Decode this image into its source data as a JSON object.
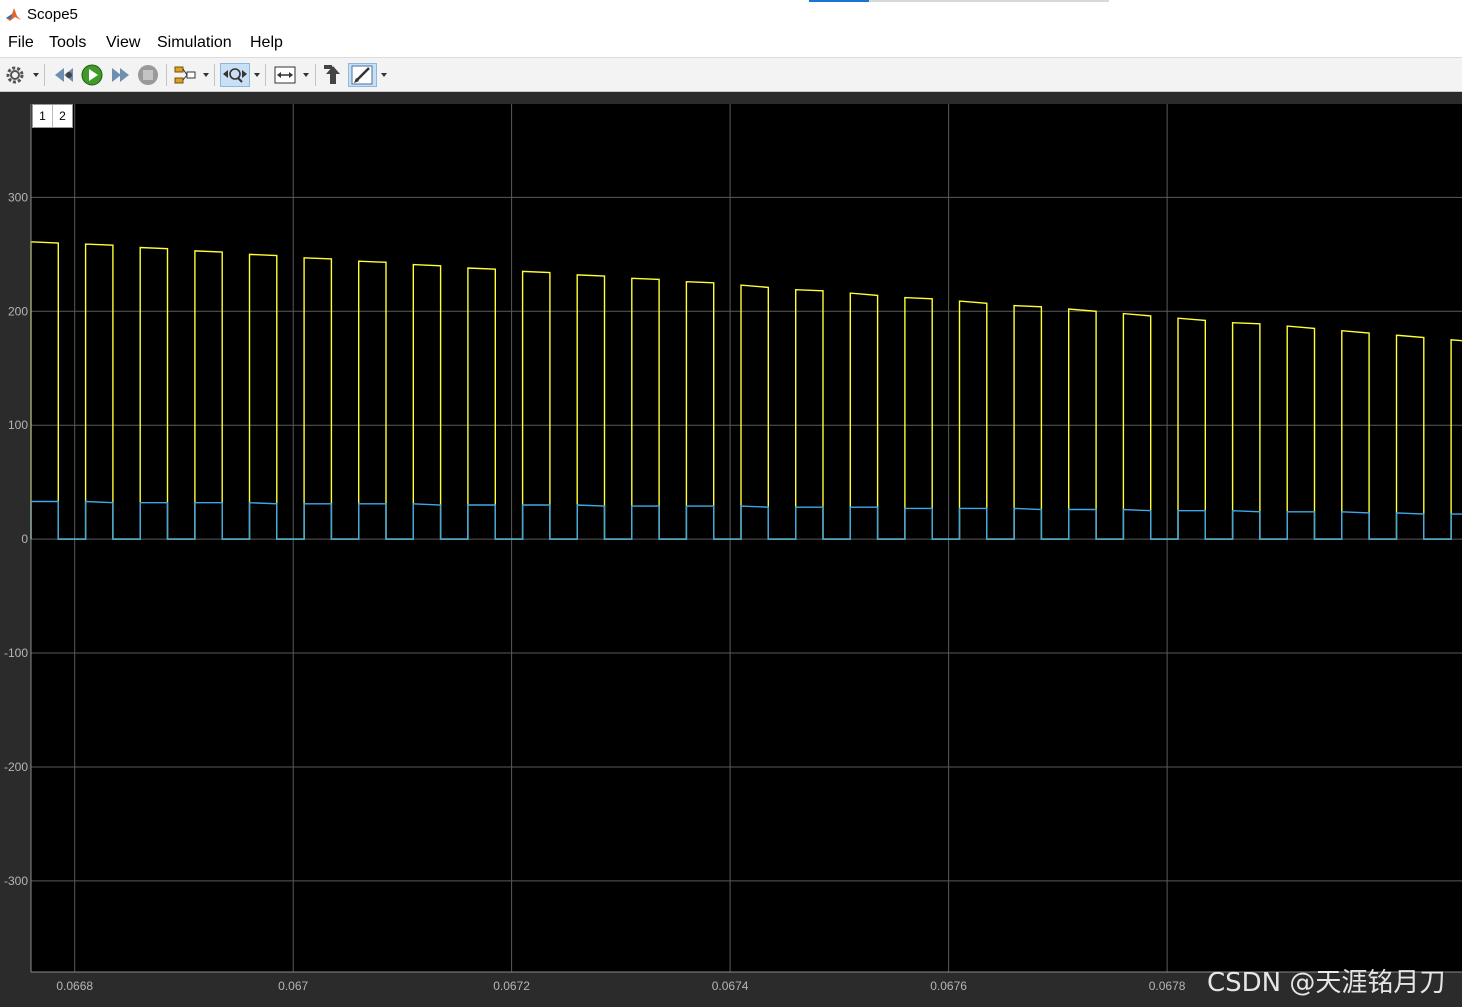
{
  "window": {
    "title": "Scope5"
  },
  "menu": [
    "File",
    "Tools",
    "View",
    "Simulation",
    "Help"
  ],
  "toolbar": {
    "icons": [
      "gear-icon",
      "step-back-icon",
      "run-icon",
      "step-forward-icon",
      "stop-icon",
      "signal-selector-icon",
      "zoom-icon",
      "fit-axes-icon",
      "highlight-block-icon",
      "style-icon"
    ],
    "active": [
      "zoom-icon",
      "style-icon"
    ]
  },
  "layout_badge": {
    "left": "1",
    "right": "2"
  },
  "colors": {
    "plot_bg": "#000000",
    "grid": "#5a5a5a",
    "series_yellow": "#ffff33",
    "series_blue": "#3da8e8",
    "figure_bg": "#2b2b2b"
  },
  "chart_data": {
    "type": "line",
    "xlim": [
      0.06676,
      0.06807
    ],
    "ylim": [
      -380,
      382
    ],
    "x_ticks": [
      0.0668,
      0.067,
      0.0672,
      0.0674,
      0.0676,
      0.0678
    ],
    "x_tick_labels": [
      "0.0668",
      "0.067",
      "0.0672",
      "0.0674",
      "0.0676",
      "0.0678"
    ],
    "y_ticks": [
      300,
      200,
      100,
      0,
      -100,
      -200,
      -300
    ],
    "y_tick_labels": [
      "300",
      "200",
      "100",
      "0",
      "-100",
      "-200",
      "-300"
    ],
    "grid": true,
    "pulse_period": 5e-05,
    "pulse_duty": 0.5,
    "pulse_start": 0.06676,
    "series": [
      {
        "color": "#ffff33",
        "pulse_high_start": [
          261,
          259,
          256,
          253,
          250,
          247,
          244,
          241,
          238,
          235,
          232,
          229,
          226,
          223,
          219,
          216,
          212,
          209,
          205,
          202,
          198,
          194,
          190,
          187,
          183,
          179,
          175
        ],
        "pulse_high_end": [
          260,
          258,
          255,
          252,
          249,
          246,
          243,
          240,
          237,
          234,
          231,
          228,
          225,
          221,
          218,
          214,
          211,
          207,
          204,
          200,
          196,
          192,
          189,
          185,
          181,
          177,
          173
        ],
        "low": 0
      },
      {
        "color": "#3da8e8",
        "pulse_high_start": [
          33,
          33,
          32,
          32,
          32,
          31,
          31,
          31,
          30,
          30,
          30,
          29,
          29,
          29,
          28,
          28,
          27,
          27,
          27,
          26,
          26,
          25,
          25,
          24,
          24,
          23,
          22
        ],
        "pulse_high_end": [
          33,
          32,
          32,
          32,
          31,
          31,
          31,
          30,
          30,
          30,
          29,
          29,
          29,
          28,
          28,
          28,
          27,
          27,
          26,
          26,
          25,
          25,
          24,
          24,
          23,
          22,
          22
        ],
        "low": 0
      }
    ]
  },
  "watermark": "CSDN @天涯铭月刀"
}
